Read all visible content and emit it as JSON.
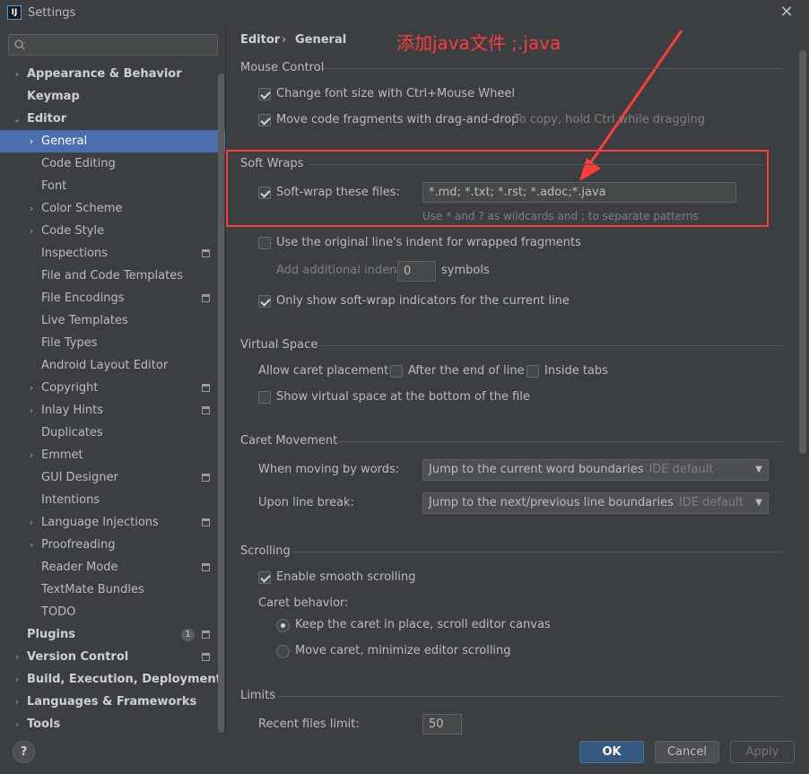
{
  "window": {
    "title": "Settings",
    "app_icon_text": "IJ",
    "close": "✕"
  },
  "search": {
    "placeholder": "",
    "icon": "search-icon"
  },
  "sidebar": {
    "items": [
      {
        "label": "Appearance & Behavior",
        "bold": true,
        "arrow": "›"
      },
      {
        "label": "Keymap",
        "bold": true,
        "arrow": ""
      },
      {
        "label": "Editor",
        "bold": true,
        "arrow": "⌄"
      },
      {
        "label": "General",
        "arrow": "›",
        "selected": true
      },
      {
        "label": "Code Editing",
        "arrow": ""
      },
      {
        "label": "Font",
        "arrow": ""
      },
      {
        "label": "Color Scheme",
        "arrow": "›"
      },
      {
        "label": "Code Style",
        "arrow": "›"
      },
      {
        "label": "Inspections",
        "arrow": "",
        "project": true
      },
      {
        "label": "File and Code Templates",
        "arrow": ""
      },
      {
        "label": "File Encodings",
        "arrow": "",
        "project": true
      },
      {
        "label": "Live Templates",
        "arrow": ""
      },
      {
        "label": "File Types",
        "arrow": ""
      },
      {
        "label": "Android Layout Editor",
        "arrow": ""
      },
      {
        "label": "Copyright",
        "arrow": "›",
        "project": true
      },
      {
        "label": "Inlay Hints",
        "arrow": "›",
        "project": true
      },
      {
        "label": "Duplicates",
        "arrow": ""
      },
      {
        "label": "Emmet",
        "arrow": "›"
      },
      {
        "label": "GUI Designer",
        "arrow": "",
        "project": true
      },
      {
        "label": "Intentions",
        "arrow": ""
      },
      {
        "label": "Language Injections",
        "arrow": "›",
        "project": true
      },
      {
        "label": "Proofreading",
        "arrow": "›"
      },
      {
        "label": "Reader Mode",
        "arrow": "",
        "project": true
      },
      {
        "label": "TextMate Bundles",
        "arrow": ""
      },
      {
        "label": "TODO",
        "arrow": ""
      },
      {
        "label": "Plugins",
        "bold": true,
        "arrow": "",
        "badge": "1",
        "project": true
      },
      {
        "label": "Version Control",
        "bold": true,
        "arrow": "›",
        "project": true
      },
      {
        "label": "Build, Execution, Deployment",
        "bold": true,
        "arrow": "›"
      },
      {
        "label": "Languages & Frameworks",
        "bold": true,
        "arrow": "›"
      },
      {
        "label": "Tools",
        "bold": true,
        "arrow": "›"
      }
    ]
  },
  "breadcrumb": {
    "parent": "Editor",
    "sep": "›",
    "current": "General"
  },
  "annotation": "添加java文件 ;.java",
  "mouse_control": {
    "title": "Mouse Control",
    "font_size_label": "Change font size with Ctrl+Mouse Wheel",
    "font_size_checked": true,
    "drag_drop_label": "Move code fragments with drag-and-drop",
    "drag_drop_checked": true,
    "drag_drop_hint": "To copy, hold Ctrl while dragging"
  },
  "soft_wraps": {
    "title": "Soft Wraps",
    "wrap_label": "Soft-wrap these files:",
    "wrap_checked": true,
    "wrap_value": "*.md; *.txt; *.rst; *.adoc;*.java",
    "wrap_hint": "Use * and ? as wildcards and ; to separate patterns",
    "indent_label": "Use the original line's indent for wrapped fragments",
    "indent_checked": false,
    "additional_indent_label": "Add additional indent:",
    "additional_indent_value": "0",
    "symbols_label": "symbols",
    "indicators_label": "Only show soft-wrap indicators for the current line",
    "indicators_checked": true
  },
  "virtual_space": {
    "title": "Virtual Space",
    "caret_placement_label": "Allow caret placement:",
    "after_end_label": "After the end of line",
    "inside_tabs_label": "Inside tabs",
    "show_bottom_label": "Show virtual space at the bottom of the file"
  },
  "caret_movement": {
    "title": "Caret Movement",
    "words_label": "When moving by words:",
    "words_value": "Jump to the current word boundaries",
    "words_default": "IDE default",
    "line_break_label": "Upon line break:",
    "line_break_value": "Jump to the next/previous line boundaries",
    "line_break_default": "IDE default"
  },
  "scrolling": {
    "title": "Scrolling",
    "smooth_label": "Enable smooth scrolling",
    "smooth_checked": true,
    "caret_behavior_label": "Caret behavior:",
    "keep_caret_label": "Keep the caret in place, scroll editor canvas",
    "move_caret_label": "Move caret, minimize editor scrolling"
  },
  "limits": {
    "title": "Limits",
    "recent_files_label": "Recent files limit:",
    "recent_files_value": "50"
  },
  "footer": {
    "help": "?",
    "ok": "OK",
    "cancel": "Cancel",
    "apply": "Apply"
  },
  "colors": {
    "selection": "#4b6eaf",
    "annotation": "#ff3b3b",
    "ok": "#365880"
  }
}
